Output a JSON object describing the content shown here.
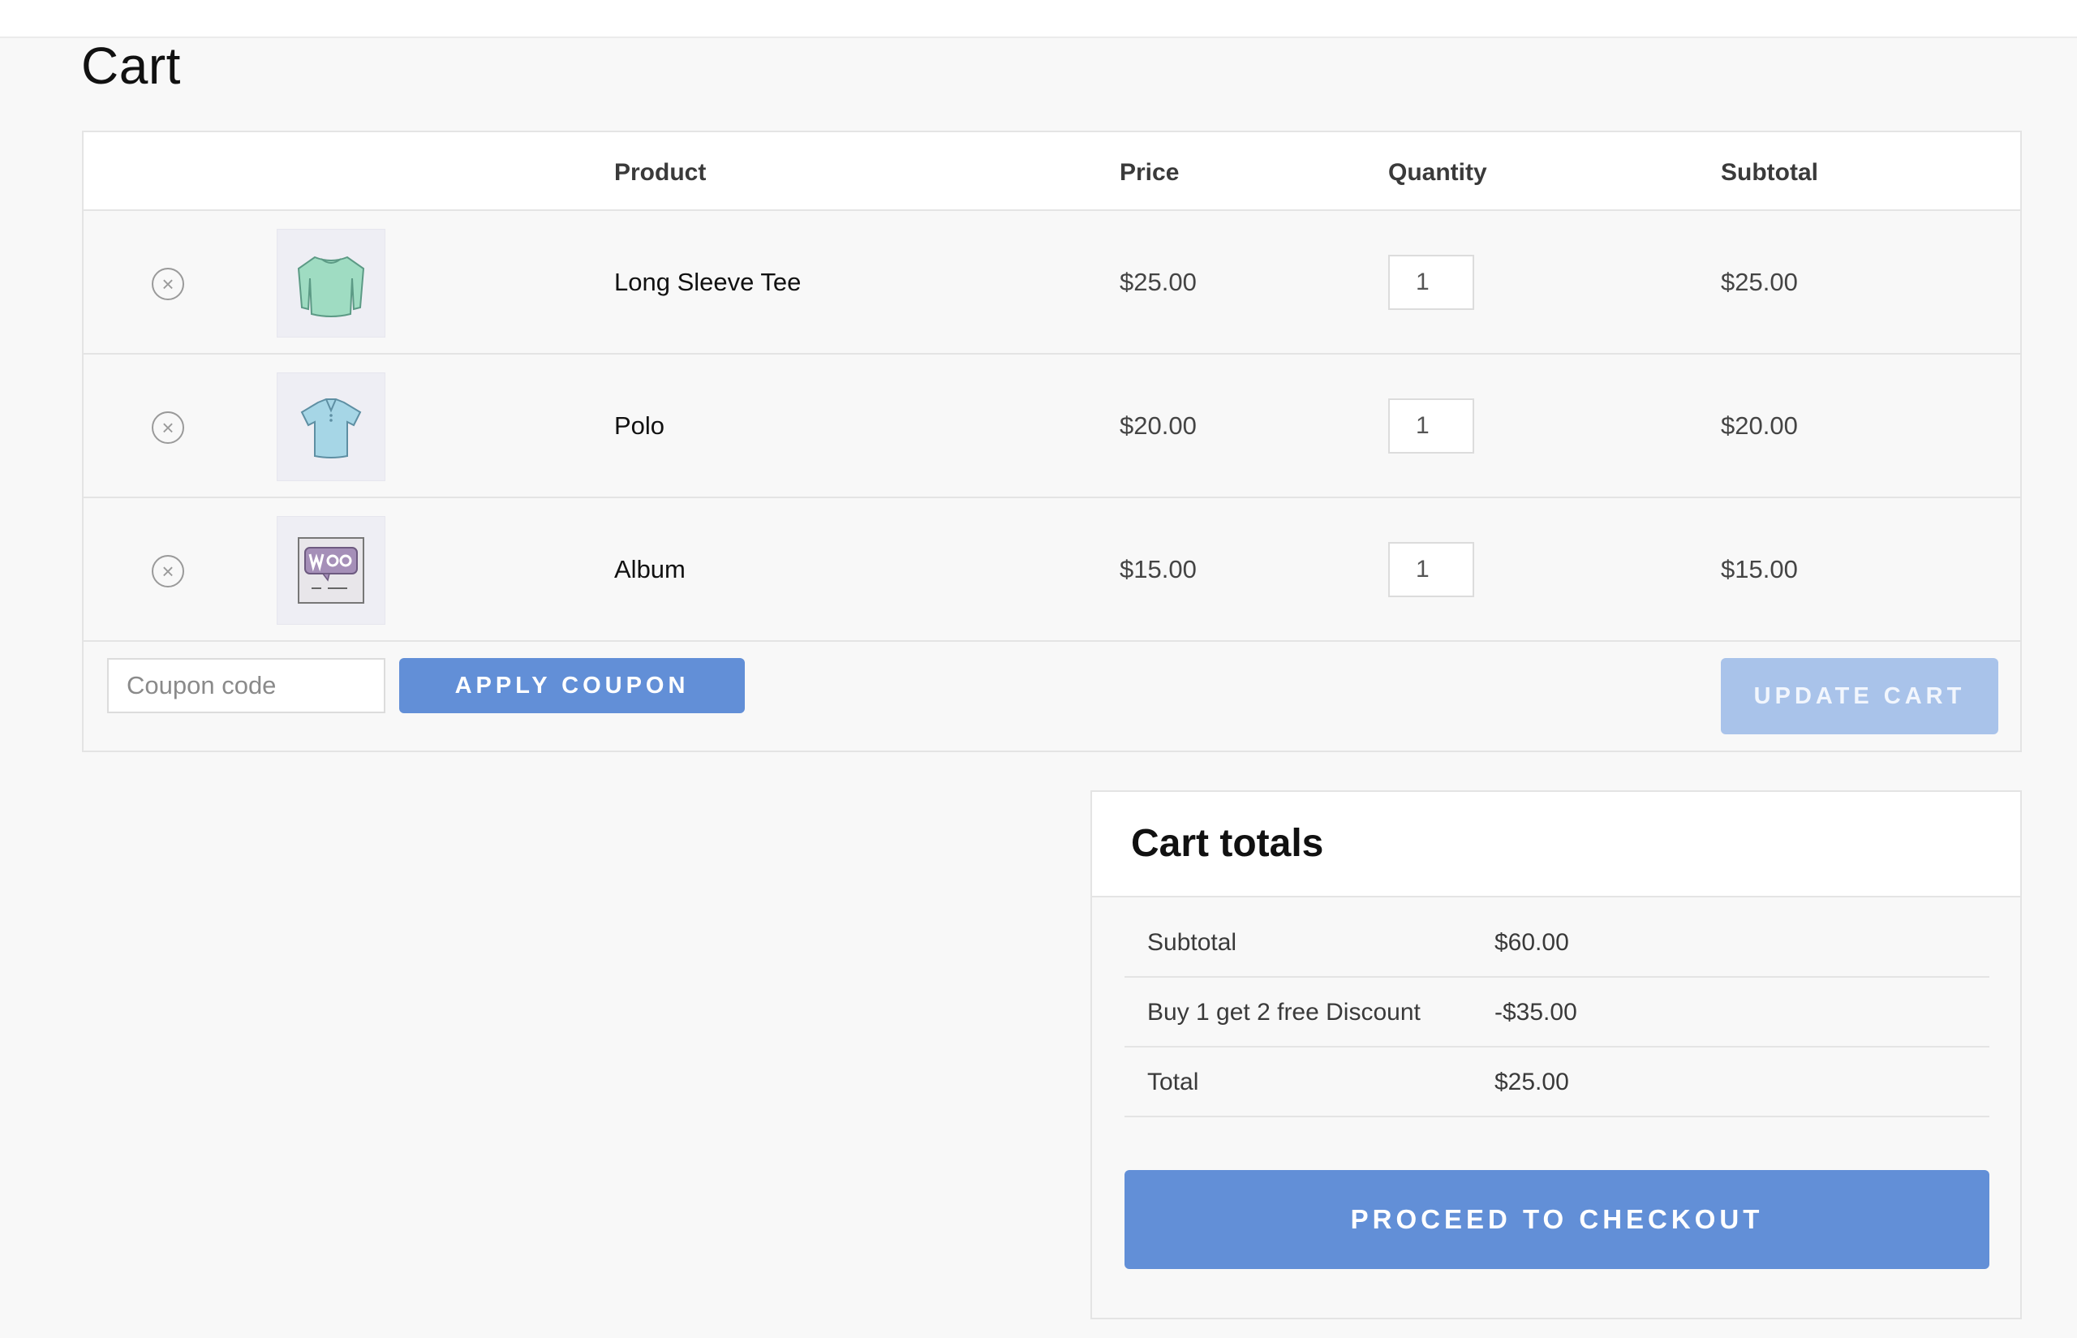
{
  "page": {
    "title": "Cart"
  },
  "table": {
    "headers": {
      "product": "Product",
      "price": "Price",
      "quantity": "Quantity",
      "subtotal": "Subtotal"
    },
    "items": [
      {
        "name": "Long Sleeve Tee",
        "price": "$25.00",
        "quantity": "1",
        "subtotal": "$25.00",
        "thumb_icon": "long-sleeve-tee-icon",
        "remove_icon": "remove-icon"
      },
      {
        "name": "Polo",
        "price": "$20.00",
        "quantity": "1",
        "subtotal": "$20.00",
        "thumb_icon": "polo-shirt-icon",
        "remove_icon": "remove-icon"
      },
      {
        "name": "Album",
        "price": "$15.00",
        "quantity": "1",
        "subtotal": "$15.00",
        "thumb_icon": "woo-album-icon",
        "remove_icon": "remove-icon"
      }
    ]
  },
  "actions": {
    "coupon_placeholder": "Coupon code",
    "apply_coupon_label": "APPLY COUPON",
    "update_cart_label": "UPDATE CART"
  },
  "totals": {
    "title": "Cart totals",
    "rows": [
      {
        "label": "Subtotal",
        "value": "$60.00"
      },
      {
        "label": "Buy 1 get 2 free Discount",
        "value": "-$35.00"
      },
      {
        "label": "Total",
        "value": "$25.00"
      }
    ],
    "checkout_label": "PROCEED TO CHECKOUT"
  },
  "colors": {
    "accent": "#628fd7",
    "accent_disabled": "#a9c3ea",
    "border": "#e4e4e4",
    "background": "#f8f8f8"
  }
}
